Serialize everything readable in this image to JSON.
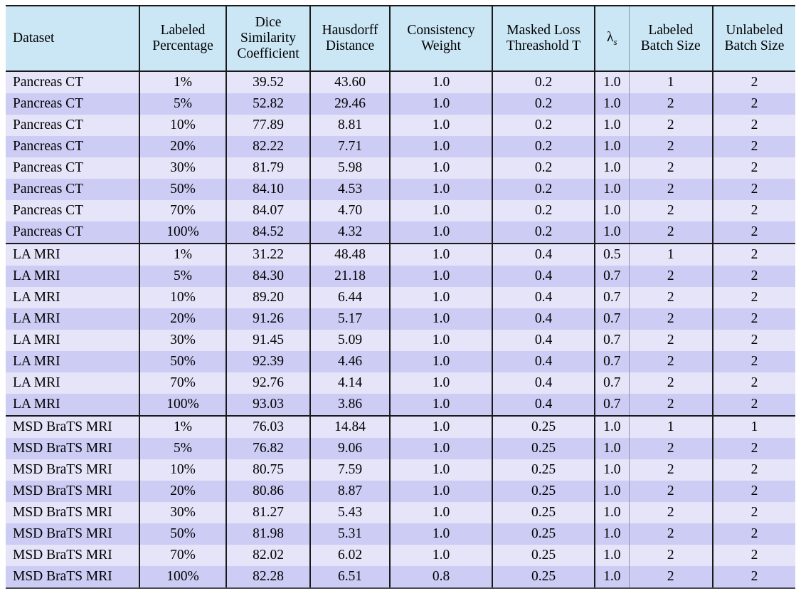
{
  "table": {
    "headers": [
      "Dataset",
      "Labeled Percentage",
      "Dice Similarity Coefficient",
      "Hausdorff Distance",
      "Consistency Weight",
      "Masked Loss Threashold T",
      "λ_s",
      "Labeled Batch Size",
      "Unlabeled Batch Size"
    ],
    "header_lines": {
      "dataset": [
        "Dataset"
      ],
      "labeled_percentage": [
        "Labeled",
        "Percentage"
      ],
      "dice_similarity_coefficient": [
        "Dice",
        "Similarity",
        "Coefficient"
      ],
      "hausdorff_distance": [
        "Hausdorff",
        "Distance"
      ],
      "consistency_weight": [
        "Consistency",
        "Weight"
      ],
      "masked_loss_threshold": [
        "Masked Loss",
        "Threashold T"
      ],
      "lambda_s": [
        "λ",
        "s"
      ],
      "labeled_batch_size": [
        "Labeled",
        "Batch Size"
      ],
      "unlabeled_batch_size": [
        "Unlabeled",
        "Batch Size"
      ]
    },
    "colors": {
      "header_background": "#cbe7f5",
      "row_light": "#e6e4f8",
      "row_dark": "#ccccf4",
      "border_dark": "#1a1a1a",
      "border_light": "#8e8ea8",
      "text": "#000000"
    },
    "groups": [
      {
        "name": "Pancreas CT",
        "rows": [
          {
            "dataset": "Pancreas CT",
            "labeled_percentage": "1%",
            "dsc": "39.52",
            "hd": "43.60",
            "consistency_weight": "1.0",
            "masked_loss_threshold": "0.2",
            "lambda_s": "1.0",
            "labeled_batch_size": "1",
            "unlabeled_batch_size": "2"
          },
          {
            "dataset": "Pancreas CT",
            "labeled_percentage": "5%",
            "dsc": "52.82",
            "hd": "29.46",
            "consistency_weight": "1.0",
            "masked_loss_threshold": "0.2",
            "lambda_s": "1.0",
            "labeled_batch_size": "2",
            "unlabeled_batch_size": "2"
          },
          {
            "dataset": "Pancreas CT",
            "labeled_percentage": "10%",
            "dsc": "77.89",
            "hd": "8.81",
            "consistency_weight": "1.0",
            "masked_loss_threshold": "0.2",
            "lambda_s": "1.0",
            "labeled_batch_size": "2",
            "unlabeled_batch_size": "2"
          },
          {
            "dataset": "Pancreas CT",
            "labeled_percentage": "20%",
            "dsc": "82.22",
            "hd": "7.71",
            "consistency_weight": "1.0",
            "masked_loss_threshold": "0.2",
            "lambda_s": "1.0",
            "labeled_batch_size": "2",
            "unlabeled_batch_size": "2"
          },
          {
            "dataset": "Pancreas CT",
            "labeled_percentage": "30%",
            "dsc": "81.79",
            "hd": "5.98",
            "consistency_weight": "1.0",
            "masked_loss_threshold": "0.2",
            "lambda_s": "1.0",
            "labeled_batch_size": "2",
            "unlabeled_batch_size": "2"
          },
          {
            "dataset": "Pancreas CT",
            "labeled_percentage": "50%",
            "dsc": "84.10",
            "hd": "4.53",
            "consistency_weight": "1.0",
            "masked_loss_threshold": "0.2",
            "lambda_s": "1.0",
            "labeled_batch_size": "2",
            "unlabeled_batch_size": "2"
          },
          {
            "dataset": "Pancreas CT",
            "labeled_percentage": "70%",
            "dsc": "84.07",
            "hd": "4.70",
            "consistency_weight": "1.0",
            "masked_loss_threshold": "0.2",
            "lambda_s": "1.0",
            "labeled_batch_size": "2",
            "unlabeled_batch_size": "2"
          },
          {
            "dataset": "Pancreas CT",
            "labeled_percentage": "100%",
            "dsc": "84.52",
            "hd": "4.32",
            "consistency_weight": "1.0",
            "masked_loss_threshold": "0.2",
            "lambda_s": "1.0",
            "labeled_batch_size": "2",
            "unlabeled_batch_size": "2"
          }
        ]
      },
      {
        "name": "LA MRI",
        "rows": [
          {
            "dataset": "LA MRI",
            "labeled_percentage": "1%",
            "dsc": "31.22",
            "hd": "48.48",
            "consistency_weight": "1.0",
            "masked_loss_threshold": "0.4",
            "lambda_s": "0.5",
            "labeled_batch_size": "1",
            "unlabeled_batch_size": "2"
          },
          {
            "dataset": "LA MRI",
            "labeled_percentage": "5%",
            "dsc": "84.30",
            "hd": "21.18",
            "consistency_weight": "1.0",
            "masked_loss_threshold": "0.4",
            "lambda_s": "0.7",
            "labeled_batch_size": "2",
            "unlabeled_batch_size": "2"
          },
          {
            "dataset": "LA MRI",
            "labeled_percentage": "10%",
            "dsc": "89.20",
            "hd": "6.44",
            "consistency_weight": "1.0",
            "masked_loss_threshold": "0.4",
            "lambda_s": "0.7",
            "labeled_batch_size": "2",
            "unlabeled_batch_size": "2"
          },
          {
            "dataset": "LA MRI",
            "labeled_percentage": "20%",
            "dsc": "91.26",
            "hd": "5.17",
            "consistency_weight": "1.0",
            "masked_loss_threshold": "0.4",
            "lambda_s": "0.7",
            "labeled_batch_size": "2",
            "unlabeled_batch_size": "2"
          },
          {
            "dataset": "LA MRI",
            "labeled_percentage": "30%",
            "dsc": "91.45",
            "hd": "5.09",
            "consistency_weight": "1.0",
            "masked_loss_threshold": "0.4",
            "lambda_s": "0.7",
            "labeled_batch_size": "2",
            "unlabeled_batch_size": "2"
          },
          {
            "dataset": "LA MRI",
            "labeled_percentage": "50%",
            "dsc": "92.39",
            "hd": "4.46",
            "consistency_weight": "1.0",
            "masked_loss_threshold": "0.4",
            "lambda_s": "0.7",
            "labeled_batch_size": "2",
            "unlabeled_batch_size": "2"
          },
          {
            "dataset": "LA MRI",
            "labeled_percentage": "70%",
            "dsc": "92.76",
            "hd": "4.14",
            "consistency_weight": "1.0",
            "masked_loss_threshold": "0.4",
            "lambda_s": "0.7",
            "labeled_batch_size": "2",
            "unlabeled_batch_size": "2"
          },
          {
            "dataset": "LA MRI",
            "labeled_percentage": "100%",
            "dsc": "93.03",
            "hd": "3.86",
            "consistency_weight": "1.0",
            "masked_loss_threshold": "0.4",
            "lambda_s": "0.7",
            "labeled_batch_size": "2",
            "unlabeled_batch_size": "2"
          }
        ]
      },
      {
        "name": "MSD BraTS MRI",
        "rows": [
          {
            "dataset": "MSD BraTS MRI",
            "labeled_percentage": "1%",
            "dsc": "76.03",
            "hd": "14.84",
            "consistency_weight": "1.0",
            "masked_loss_threshold": "0.25",
            "lambda_s": "1.0",
            "labeled_batch_size": "1",
            "unlabeled_batch_size": "1"
          },
          {
            "dataset": "MSD BraTS MRI",
            "labeled_percentage": "5%",
            "dsc": "76.82",
            "hd": "9.06",
            "consistency_weight": "1.0",
            "masked_loss_threshold": "0.25",
            "lambda_s": "1.0",
            "labeled_batch_size": "2",
            "unlabeled_batch_size": "2"
          },
          {
            "dataset": "MSD BraTS MRI",
            "labeled_percentage": "10%",
            "dsc": "80.75",
            "hd": "7.59",
            "consistency_weight": "1.0",
            "masked_loss_threshold": "0.25",
            "lambda_s": "1.0",
            "labeled_batch_size": "2",
            "unlabeled_batch_size": "2"
          },
          {
            "dataset": "MSD BraTS MRI",
            "labeled_percentage": "20%",
            "dsc": "80.86",
            "hd": "8.87",
            "consistency_weight": "1.0",
            "masked_loss_threshold": "0.25",
            "lambda_s": "1.0",
            "labeled_batch_size": "2",
            "unlabeled_batch_size": "2"
          },
          {
            "dataset": "MSD BraTS MRI",
            "labeled_percentage": "30%",
            "dsc": "81.27",
            "hd": "5.43",
            "consistency_weight": "1.0",
            "masked_loss_threshold": "0.25",
            "lambda_s": "1.0",
            "labeled_batch_size": "2",
            "unlabeled_batch_size": "2"
          },
          {
            "dataset": "MSD BraTS MRI",
            "labeled_percentage": "50%",
            "dsc": "81.98",
            "hd": "5.31",
            "consistency_weight": "1.0",
            "masked_loss_threshold": "0.25",
            "lambda_s": "1.0",
            "labeled_batch_size": "2",
            "unlabeled_batch_size": "2"
          },
          {
            "dataset": "MSD BraTS MRI",
            "labeled_percentage": "70%",
            "dsc": "82.02",
            "hd": "6.02",
            "consistency_weight": "1.0",
            "masked_loss_threshold": "0.25",
            "lambda_s": "1.0",
            "labeled_batch_size": "2",
            "unlabeled_batch_size": "2"
          },
          {
            "dataset": "MSD BraTS MRI",
            "labeled_percentage": "100%",
            "dsc": "82.28",
            "hd": "6.51",
            "consistency_weight": "0.8",
            "masked_loss_threshold": "0.25",
            "lambda_s": "1.0",
            "labeled_batch_size": "2",
            "unlabeled_batch_size": "2"
          }
        ]
      }
    ]
  }
}
